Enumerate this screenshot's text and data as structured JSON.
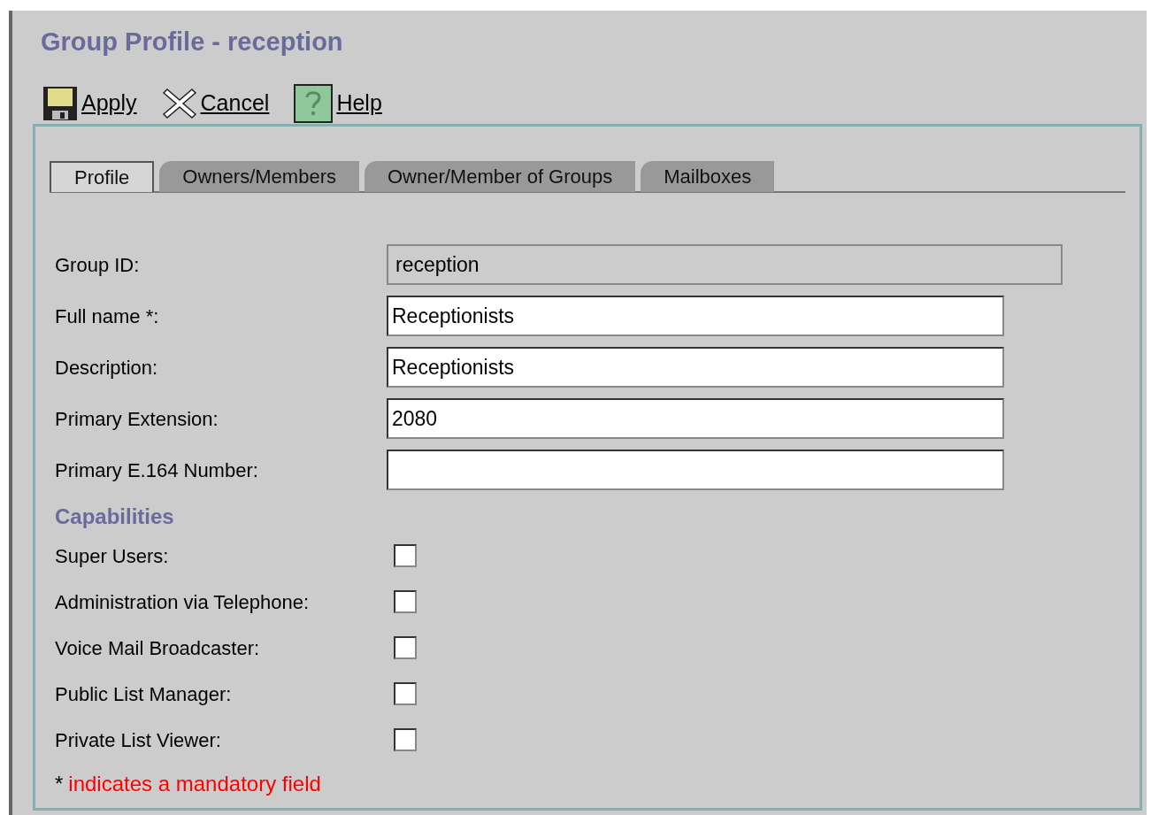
{
  "title": "Group Profile - reception",
  "toolbar": [
    {
      "kind": "save",
      "label": "Apply"
    },
    {
      "kind": "cancel",
      "label": "Cancel"
    },
    {
      "kind": "help",
      "label": "Help"
    }
  ],
  "tabs": [
    {
      "label": "Profile",
      "selected": true
    },
    {
      "label": "Owners/Members",
      "selected": false
    },
    {
      "label": "Owner/Member of Groups",
      "selected": false
    },
    {
      "label": "Mailboxes",
      "selected": false
    }
  ],
  "fields": [
    {
      "label": "Group ID:",
      "value": "reception",
      "disabled": true
    },
    {
      "label": "Full name *:",
      "value": "Receptionists",
      "disabled": false
    },
    {
      "label": "Description:",
      "value": "Receptionists",
      "disabled": false
    },
    {
      "label": "Primary Extension:",
      "value": "2080",
      "disabled": false
    },
    {
      "label": "Primary E.164 Number:",
      "disabled": false
    }
  ],
  "capabilities": {
    "heading": "Capabilities",
    "items": [
      {
        "label": "Super Users:",
        "checked": false
      },
      {
        "label": "Administration via Telephone:",
        "checked": false
      },
      {
        "label": "Voice Mail Broadcaster:",
        "checked": false
      },
      {
        "label": "Public List Manager:",
        "checked": false
      },
      {
        "label": "Private List Viewer:",
        "checked": false
      }
    ]
  },
  "note": {
    "marker": "*",
    "text": "indicates a mandatory field"
  }
}
